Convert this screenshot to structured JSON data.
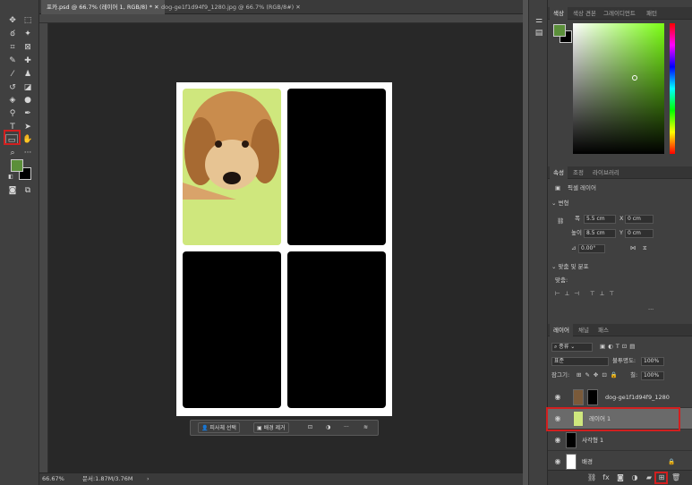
{
  "tabs": [
    {
      "label": "포카.psd @ 66.7% (레이어 1, RGB/8) *",
      "active": true
    },
    {
      "label": "dog-ge1f1d94f9_1280.jpg @ 66.7% (RGB/8#)",
      "active": false
    }
  ],
  "status": {
    "zoom": "66.67%",
    "doc": "문서:1.87M/3.76M"
  },
  "context_bar": {
    "select_subject": "피사체 선택",
    "remove_bg": "배경 제거",
    "more": "···"
  },
  "panel_color": {
    "tabs": [
      "색상",
      "색상 견본",
      "그레이디언트",
      "패턴"
    ],
    "foreground": "#5b8f3a",
    "background": "#000000"
  },
  "panel_props": {
    "tabs": [
      "속성",
      "조정",
      "라이브러리"
    ],
    "kind": "픽셀 레이어",
    "transform": "변형",
    "w_label": "폭",
    "w": "5.5 cm",
    "x_label": "X",
    "x": "0 cm",
    "h_label": "높이",
    "h": "8.5 cm",
    "y_label": "Y",
    "y": "0 cm",
    "angle": "0.00°",
    "align_section": "맞춤 및 분포",
    "align_label": "맞춤:"
  },
  "panel_layers": {
    "tabs": [
      "레이어",
      "채널",
      "패스"
    ],
    "kind": "종류",
    "blend": "표준",
    "opacity_label": "불투명도:",
    "opacity": "100%",
    "lock_label": "잠그기:",
    "fill_label": "칠:",
    "fill": "100%",
    "layers": [
      {
        "name": "dog-ge1f1d94f9_1280",
        "selected": false
      },
      {
        "name": "레이어 1",
        "selected": true
      },
      {
        "name": "사각형 1",
        "selected": false
      },
      {
        "name": "배경",
        "selected": false
      }
    ]
  }
}
